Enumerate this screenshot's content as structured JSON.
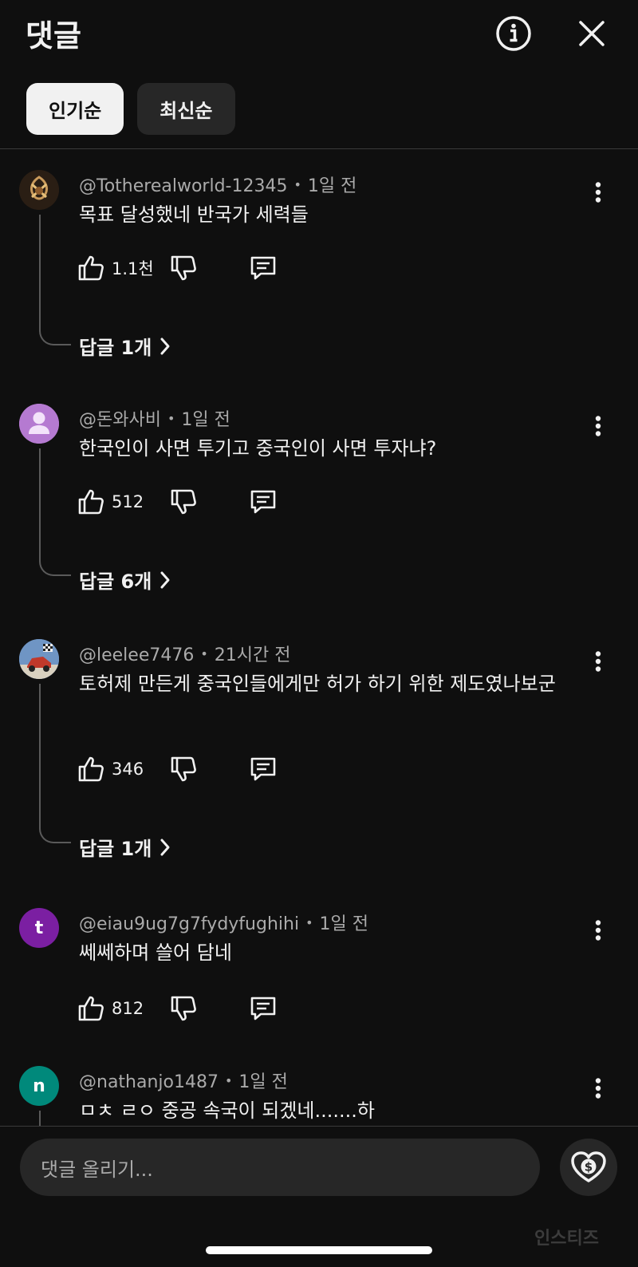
{
  "header": {
    "title": "댓글",
    "info_icon": "info-circle-icon",
    "close_icon": "close-icon"
  },
  "sort_tabs": [
    {
      "label": "인기순",
      "selected": true
    },
    {
      "label": "최신순",
      "selected": false
    }
  ],
  "comments": [
    {
      "author": "@Totherealworld-12345",
      "time": "1일 전",
      "text": "목표 달성했네 반국가 세력들",
      "likes": "1.1천",
      "replies_label": "답글 1개",
      "avatar": {
        "type": "image",
        "color": "#3b2a1c",
        "accent": "#c99a5b"
      }
    },
    {
      "author": "@돈와사비",
      "time": "1일 전",
      "text": "한국인이 사면 투기고 중국인이 사면 투자냐?",
      "likes": "512",
      "replies_label": "답글 6개",
      "avatar": {
        "type": "silhouette",
        "color": "#b57ad1"
      }
    },
    {
      "author": "@leelee7476",
      "time": "21시간 전",
      "text": "토허제 만든게 중국인들에게만 허가 하기 위한 제도였나보군",
      "likes": "346",
      "replies_label": "답글 1개",
      "avatar": {
        "type": "image",
        "color": "#6f95c4",
        "accent": "#c0392b"
      }
    },
    {
      "author": "@eiau9ug7g7fydyfughihi",
      "time": "1일 전",
      "text": "쎄쎄하며 쓸어 담네",
      "likes": "812",
      "replies_label": "",
      "avatar": {
        "type": "letter",
        "letter": "t",
        "color": "#7b1fa2"
      }
    },
    {
      "author": "@nathanjo1487",
      "time": "1일 전",
      "text": "ㅁㅊ ㄹㅇ 중공 속국이 되겠네.......하",
      "likes": "",
      "replies_label": "",
      "avatar": {
        "type": "letter",
        "letter": "n",
        "color": "#00897b"
      }
    }
  ],
  "composer": {
    "placeholder": "댓글 올리기...",
    "thanks_icon": "super-thanks-heart-dollar-icon"
  },
  "watermark": "인스티즈"
}
